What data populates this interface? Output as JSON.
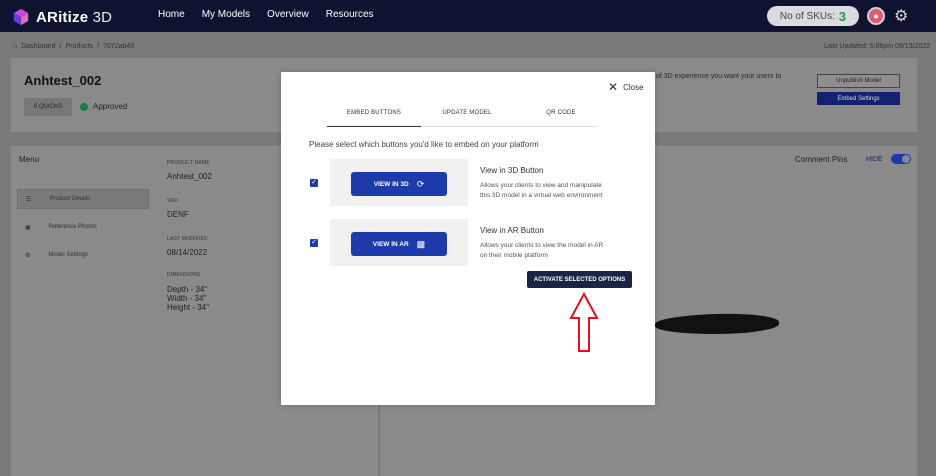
{
  "app": {
    "logo_bold": "ARitize",
    "logo_light": " 3D",
    "nav": [
      "Home",
      "My Models",
      "Overview",
      "Resources"
    ],
    "sku_label": "No of SKUs:",
    "sku_count": "3"
  },
  "page": {
    "breadcrumbs": [
      "Dashboard",
      "/",
      "Products",
      "/",
      "7072ab43"
    ],
    "last_updated": "Last Updated: 5:06pm 08/15/2022",
    "model_title": "Anhtest_002",
    "quicks": "0 QUICKS",
    "status": "Approved",
    "bg_description": "of 3D experience you want your users to",
    "unpublish_label": "Unpublish Model",
    "embed_settings_label": "Embed Settings",
    "menu_title": "Menu",
    "menu_items": [
      "Product Details",
      "Reference Photos",
      "Model Settings"
    ],
    "fields": {
      "product_name_label": "PRODUCT NAME",
      "product_name": "Anhtest_002",
      "sku_label": "SKU",
      "sku": "DENF",
      "last_modified_label": "LAST MODIFIED",
      "last_modified": "08/14/2022",
      "dimensions_label": "DIMENSIONS",
      "depth": "Depth - 34\"",
      "width": "Width - 34\"",
      "height": "Height - 34\""
    },
    "comment_pins": "Comment Pins",
    "hide": "HIDE"
  },
  "modal": {
    "close_label": "Close",
    "tabs": [
      "EMBED BUTTONS",
      "UPDATE MODEL",
      "QR CODE"
    ],
    "instruction": "Please select which buttons you'd like to embed on your platform",
    "options": [
      {
        "button_label": "VIEW IN 3D",
        "title": "View in 3D Button",
        "desc_line1": "Allows your clients to view and manipulate",
        "desc_line2": "this 3D model in a virtual web environment",
        "checked": true
      },
      {
        "button_label": "VIEW IN AR",
        "title": "View in AR Button",
        "desc_line1": "Allows your clients to view the model in AR",
        "desc_line2": "on their mobile platform",
        "checked": true
      }
    ],
    "activate_label": "ACTIVATE SELECTED OPTIONS"
  },
  "colors": {
    "nav_bg": "#0f1330",
    "primary": "#1c3aa9",
    "activate_bg": "#1b2444",
    "annotation_arrow": "#e0101c",
    "approved": "#1d7a45"
  },
  "icons": [
    "cube-logo-icon",
    "home-icon",
    "gear-icon",
    "list-icon",
    "photo-icon",
    "settings-icon",
    "close-icon",
    "3d-rotate-icon",
    "qr-code-icon",
    "up-arrow-annotation-icon"
  ]
}
